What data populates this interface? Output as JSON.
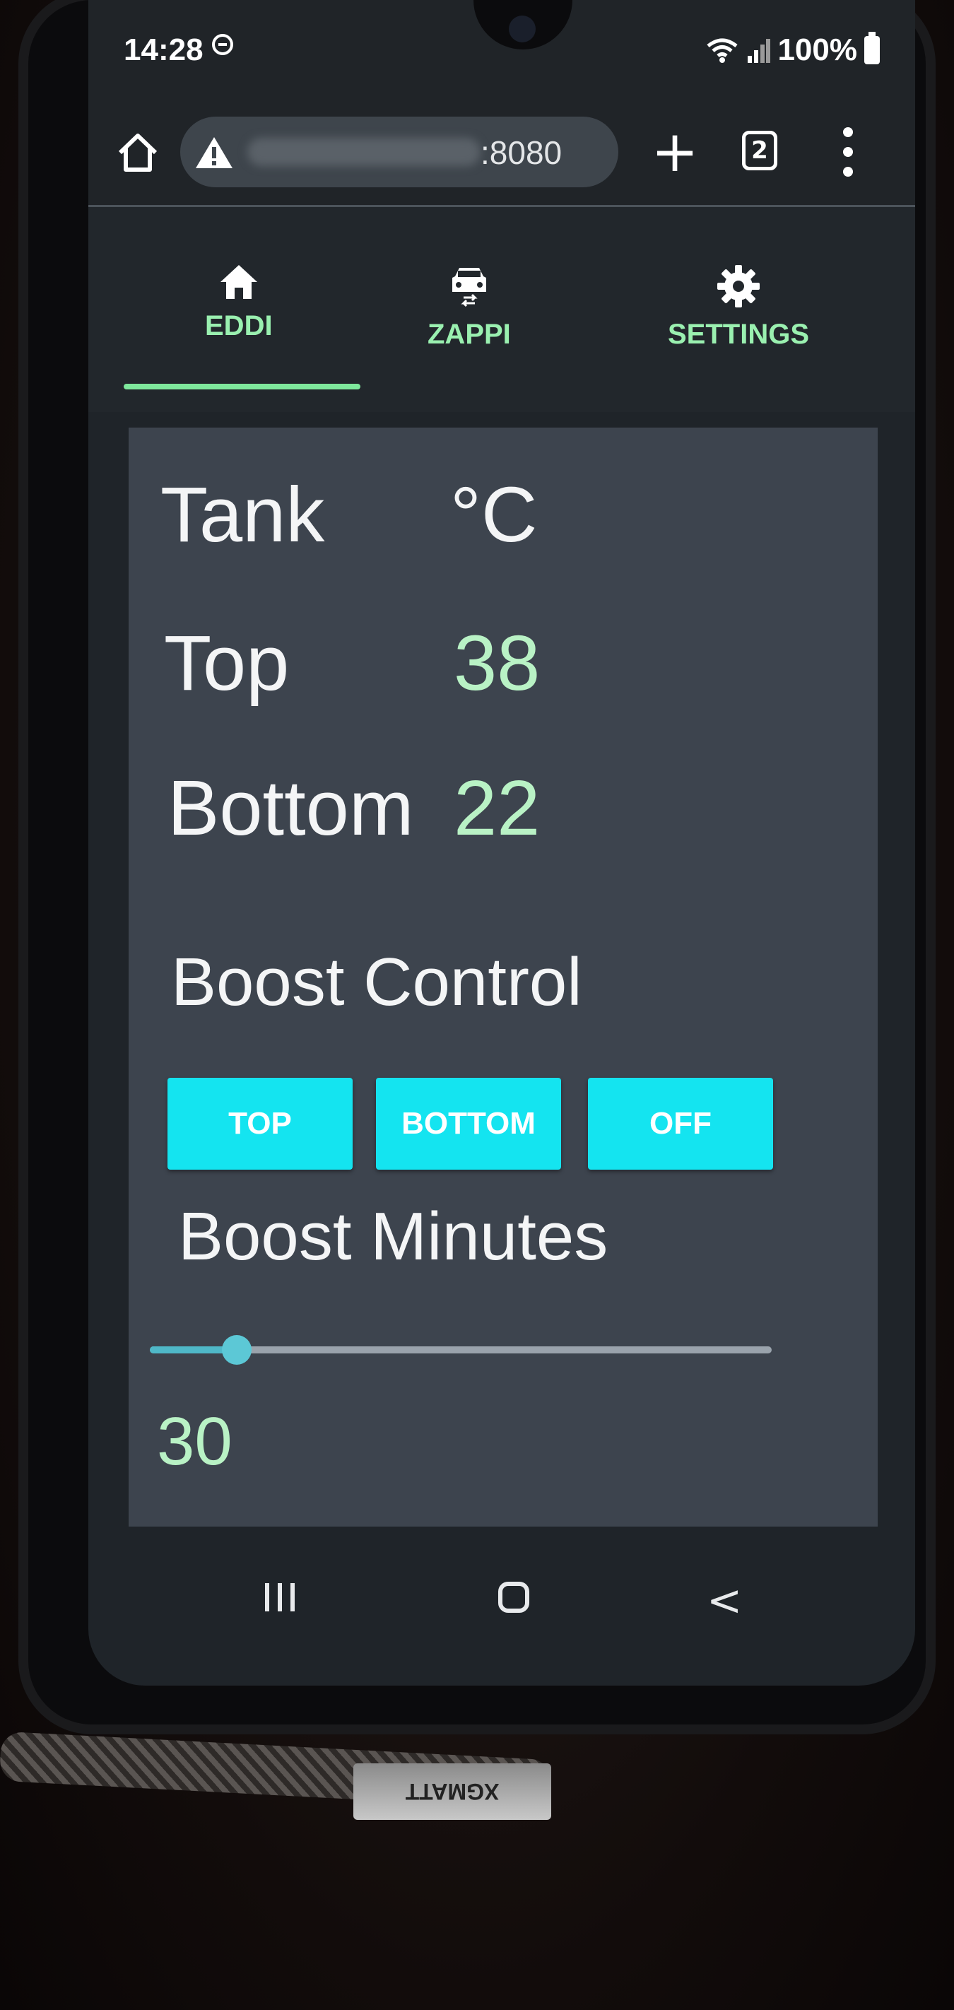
{
  "status_bar": {
    "time": "14:28",
    "battery": "100%"
  },
  "browser": {
    "url_suffix": ":8080",
    "tab_count": "2"
  },
  "nav_tabs": [
    {
      "label": "EDDI",
      "icon": "home-icon",
      "active": true
    },
    {
      "label": "ZAPPI",
      "icon": "car-charger-icon",
      "active": false
    },
    {
      "label": "SETTINGS",
      "icon": "gear-icon",
      "active": false
    }
  ],
  "tank": {
    "title": "Tank",
    "unit": "°C",
    "top_label": "Top",
    "top_value": "38",
    "bottom_label": "Bottom",
    "bottom_value": "22"
  },
  "boost": {
    "title": "Boost Control",
    "buttons": [
      "TOP",
      "BOTTOM",
      "OFF"
    ],
    "minutes_title": "Boost Minutes",
    "minutes_value": "30",
    "slider_fraction": 0.14
  },
  "cable_brand": "XGMATT",
  "colors": {
    "accent_green": "#9af0b0",
    "button_cyan": "#14e4f0",
    "card_bg": "#3d444e"
  }
}
